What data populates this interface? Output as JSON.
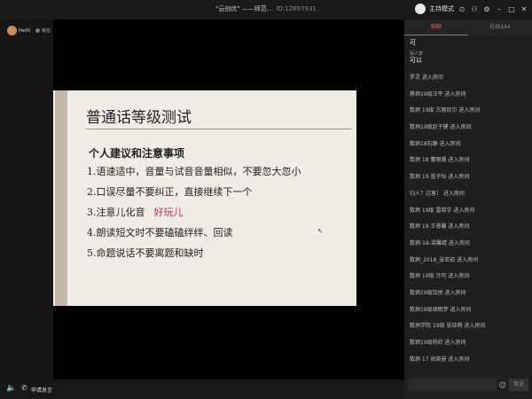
{
  "window": {
    "title": "\"云创优\" ——师范...",
    "room_id": "ID:12697931"
  },
  "titlebar": {
    "mode_label": "主持模式",
    "icons": [
      "record-icon",
      "user-icon",
      "settings-icon",
      "minimize-icon",
      "maximize-icon",
      "close-icon"
    ],
    "glyphs": [
      "⊙",
      "⚇",
      "⚙",
      "–",
      "□",
      "✕"
    ]
  },
  "host": {
    "name": "Hei抖",
    "tag": "静音"
  },
  "slide": {
    "title": "普通话等级测试",
    "subtitle": "个人建议和注意事项",
    "items": [
      "1.语速适中，音量与试音音量相似，不要忽大忽小",
      "2.口误尽量不要纠正，直接继续下一个",
      "3.注意儿化音",
      "4.朗读短文时不要磕磕绊绊、回读",
      "5.命题说话不要离题和缺时"
    ],
    "item3_highlight": "好玩儿"
  },
  "bottombar": {
    "apply_label": "申请发言"
  },
  "chat": {
    "tabs": [
      "聊聊",
      "在线144"
    ],
    "first_message": "可",
    "named_message": {
      "name": "陌人梦",
      "text": "可以"
    },
    "messages": [
      "罗灵 进入房间",
      "蔡炳19级汪平 进入房间",
      "数炳 19级 古丽尼尔 进入房间",
      "数炳19级赵子健 进入房间",
      "数炳18石静 进入房间",
      "数炳 18 曹雨珊 进入房间",
      "数炳 19 蓝子怡 进入房间",
      "归人？过客！ 进入房间",
      "数炳 19级 雷晓宇 进入房间",
      "数炳 19 王睿馨 进入房间",
      "数炳-18-梁馨婧 进入房间",
      "数炳_2018_张亚茹 进入房间",
      "数炳 19级 许可 进入房间",
      "数炳19级饶悦 进入房间",
      "数炳19级胡雨梦 进入房间",
      "数炳学院 19级 张钰萌 进入房间",
      "数炳19级杨欣 进入房间",
      "数炳 17 祝晓曼 进入房间"
    ],
    "input_placeholder": "",
    "send_label": "发送"
  }
}
